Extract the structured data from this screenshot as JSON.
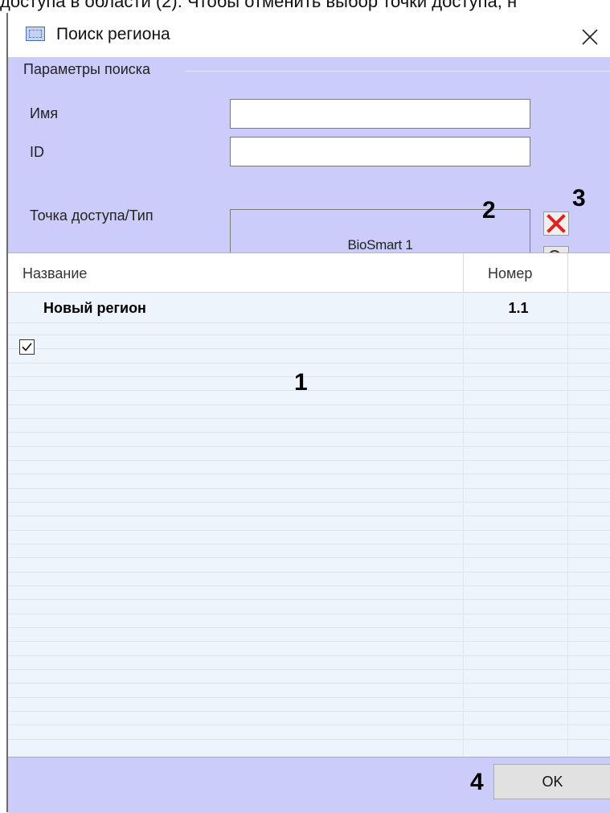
{
  "top_caption": "доступа в области (2). Чтобы отменить выбор точки доступа, н",
  "window": {
    "title": "Поиск региона",
    "close_icon": "close-icon"
  },
  "params": {
    "legend": "Параметры поиска",
    "name_label": "Имя",
    "name_value": "",
    "id_label": "ID",
    "id_value": "",
    "access_label": "Точка доступа/Тип",
    "access_value": "BioSmart 1",
    "clear_icon": "red-x-icon",
    "search_icon": "magnifier-icon"
  },
  "grid": {
    "columns": [
      "Название",
      "Номер"
    ],
    "rows": [
      {
        "checked": true,
        "name": "Новый регион",
        "number": "1.1"
      }
    ]
  },
  "footer": {
    "ok_label": "OK"
  },
  "annotations": {
    "a1": "1",
    "a2": "2",
    "a3": "3",
    "a4": "4"
  },
  "colors": {
    "panel_bg": "#ccccfb",
    "grid_bg": "#eef4fb",
    "clear_red": "#e0211c"
  }
}
